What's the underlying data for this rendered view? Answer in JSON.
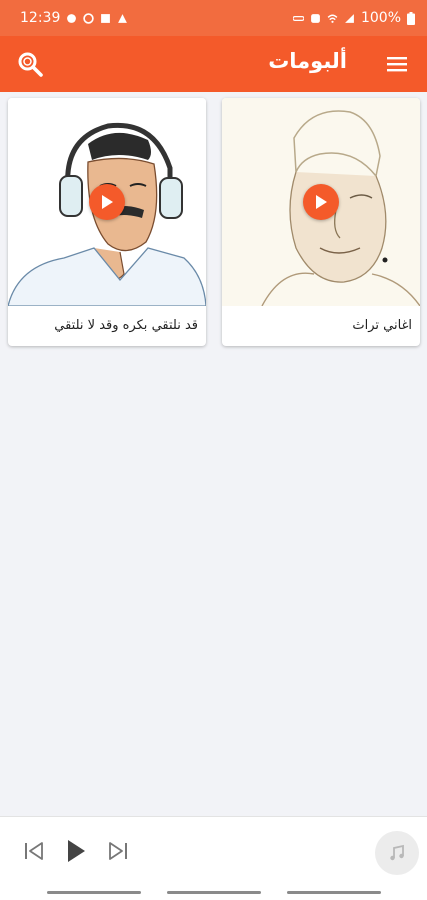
{
  "status_bar": {
    "time": "12:39",
    "battery": "100%"
  },
  "app_bar": {
    "title": "ألبومات",
    "menu_icon": "hamburger-menu-icon",
    "search_icon": "search-icon"
  },
  "albums": [
    {
      "title": "اغاني تراث",
      "cover": "sketch-portrait-elder-with-cap"
    },
    {
      "title": "قد نلتقي بكره وقد لا نلتقي",
      "cover": "sketch-portrait-man-with-headphones"
    }
  ],
  "player": {
    "prev_icon": "skip-previous-icon",
    "play_icon": "play-icon",
    "next_icon": "skip-next-icon",
    "music_icon": "music-note-icon"
  },
  "colors": {
    "accent": "#f45a2a",
    "status_bar": "#f26c3f",
    "background": "#f2f3f7"
  }
}
